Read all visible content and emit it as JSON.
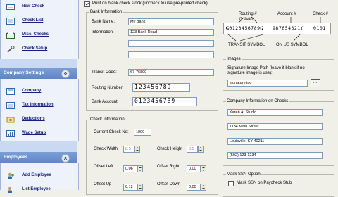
{
  "sidebar": {
    "top_items": [
      {
        "label": "New Check",
        "icon": "new-check-icon"
      },
      {
        "label": "Check List",
        "icon": "check-list-icon"
      },
      {
        "label": "Misc. Checks",
        "icon": "misc-checks-icon"
      },
      {
        "label": "Check Setup",
        "icon": "wrench-icon"
      }
    ],
    "company_settings": {
      "title": "Company Settings",
      "items": [
        {
          "label": "Company",
          "icon": "company-icon"
        },
        {
          "label": "Tax Information",
          "icon": "tax-icon"
        },
        {
          "label": "Deductions",
          "icon": "deductions-icon"
        },
        {
          "label": "Wage Setup",
          "icon": "wage-icon"
        }
      ]
    },
    "employees": {
      "title": "Employees",
      "items": [
        {
          "label": "Add Employee",
          "icon": "add-employee-icon"
        },
        {
          "label": "List Employee",
          "icon": "list-employee-icon"
        }
      ]
    }
  },
  "print_blank": {
    "label": "Print on blank check stock (uncheck to use pre-printed check)",
    "checked": true
  },
  "bank": {
    "title": "Bank Information",
    "bank_name_label": "Bank Name:",
    "bank_name": "My Bank",
    "information_label": "Information:",
    "address_line1": "123 Bank Road",
    "address_line2": "",
    "address_line3": "",
    "transit_label": "Transit Code:",
    "transit_code": "67-76890",
    "routing_label": "Routing Number:",
    "routing_number": "123456789",
    "account_label": "Bank Account:",
    "bank_account": "0123456789"
  },
  "micr": {
    "routing_label": "Routing #",
    "routing_sub": "(9 digits)",
    "account_label": "Account #",
    "check_label": "Check #",
    "line_routing": "⑆0123456789⑆",
    "line_account": "987654321⑈",
    "line_check": "0101",
    "transit_symbol": "TRANSIT SYMBOL",
    "on_us_symbol": "ON US SYMBOL"
  },
  "images": {
    "title": "Images",
    "label": "Signature Image Path (leave it blank if no signature image is use):",
    "value": "signature.jpg",
    "browse_label": "..."
  },
  "check_info": {
    "title": "Check Information",
    "current_label": "Current Check No:",
    "current_value": "1000",
    "width_label": "Check Width",
    "width_value": "8.5",
    "height_label": "Check Height",
    "height_value": "3.5",
    "offset_left_label": "Offset Left",
    "offset_left_value": "0.06",
    "offset_right_label": "Offset Right",
    "offset_right_value": "0.00",
    "offset_up_label": "Offset Up",
    "offset_up_value": "0.12",
    "offset_down_label": "Offset Down",
    "offset_down_value": "0.00"
  },
  "company_info": {
    "title": "Company Information on Checks",
    "lines": [
      "Karen At Studio",
      "1134 Main Street",
      "Louisville, KY 40211",
      "(502) 123-1234"
    ]
  },
  "mask_ssn": {
    "title": "Mask SSN Option",
    "label": "Mask SSN on Paycheck Stub",
    "checked": false
  }
}
